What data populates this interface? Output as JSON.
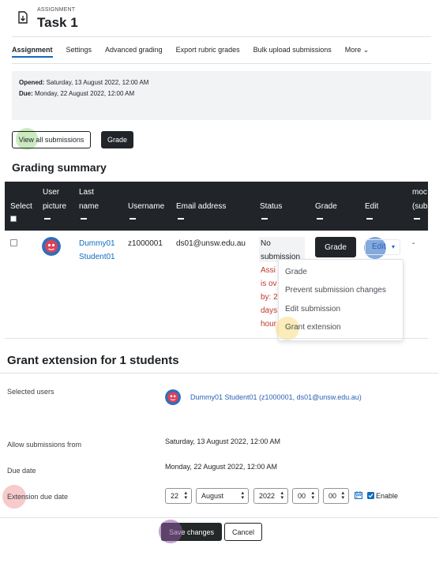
{
  "header": {
    "kicker": "ASSIGNMENT",
    "title": "Task 1",
    "icon": "document-icon"
  },
  "tabs": [
    {
      "label": "Assignment",
      "active": true
    },
    {
      "label": "Settings"
    },
    {
      "label": "Advanced grading"
    },
    {
      "label": "Export rubric grades"
    },
    {
      "label": "Bulk upload submissions"
    },
    {
      "label": "More ⌄"
    }
  ],
  "dates": {
    "opened_label": "Opened:",
    "opened_value": " Saturday, 13 August 2022, 12:00 AM",
    "due_label": "Due:",
    "due_value": " Monday, 22 August 2022, 12:00 AM"
  },
  "actions": {
    "view_all": "View all submissions",
    "grade": "Grade"
  },
  "grading_summary": "Grading summary",
  "table": {
    "headers": {
      "select": "Select",
      "user_picture_1": "User",
      "user_picture_2": "picture",
      "last_name_1": "Last",
      "last_name_2": "name",
      "username": "Username",
      "email": "Email address",
      "status": "Status",
      "grade": "Grade",
      "edit": "Edit",
      "mod_1": "moc",
      "mod_2": "(sub"
    },
    "row": {
      "name_1": "Dummy01",
      "name_2": "Student01",
      "username": "z1000001",
      "email": "ds01@unsw.edu.au",
      "status_1": "No",
      "status_2": "submission",
      "overdue": [
        "Assi",
        "is ov",
        "by: 2",
        "days",
        "hour"
      ],
      "grade_button": "Grade",
      "edit_button": "Edit",
      "mod": "-"
    },
    "edit_menu": [
      "Grade",
      "Prevent submission changes",
      "Edit submission",
      "Grant extension"
    ]
  },
  "grant": {
    "title": "Grant extension for 1 students",
    "selected_users_label": "Selected users",
    "selected_users_value": "Dummy01 Student01 (z1000001, ds01@unsw.edu.au)",
    "allow_from_label": "Allow submissions from",
    "allow_from_value": "Saturday, 13 August 2022, 12:00 AM",
    "due_label": "Due date",
    "due_value": "Monday, 22 August 2022, 12:00 AM",
    "ext_label": "Extension due date",
    "ext_day": "22",
    "ext_month": "August",
    "ext_year": "2022",
    "ext_hour": "00",
    "ext_minute": "00",
    "enable_label": "Enable",
    "enable_checked": true,
    "save": "Save changes",
    "cancel": "Cancel"
  },
  "colors": {
    "accent": "#0f6cbf",
    "dark": "#212529",
    "overdue": "#c0392b"
  }
}
